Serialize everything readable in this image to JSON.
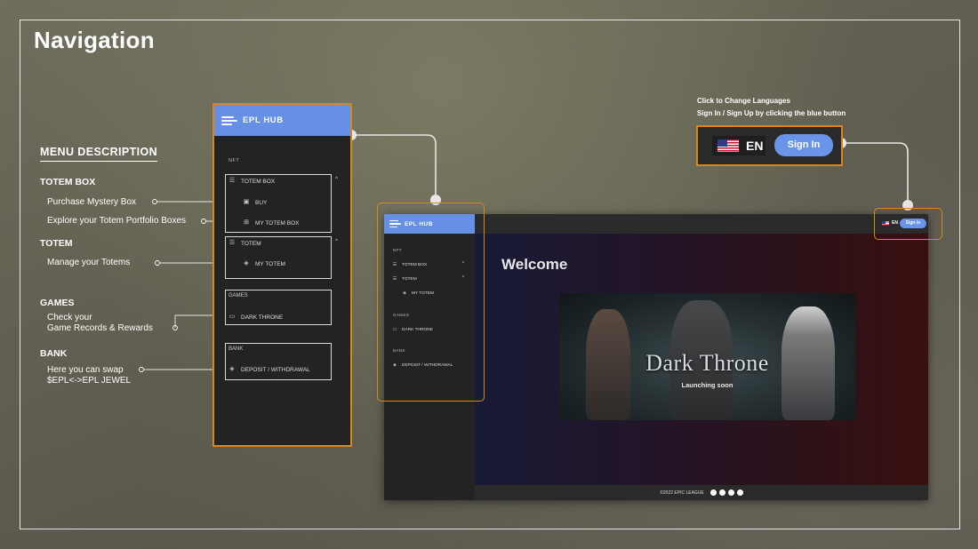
{
  "page": {
    "title": "Navigation"
  },
  "descriptions": {
    "heading": "MENU DESCRIPTION",
    "totem_box": {
      "title": "TOTEM BOX",
      "items": [
        "Purchase Mystery Box",
        "Explore your Totem Portfolio Boxes"
      ]
    },
    "totem": {
      "title": "TOTEM",
      "items": [
        "Manage your Totems"
      ]
    },
    "games": {
      "title": "GAMES",
      "line1": "Check your",
      "line2": "Game Records & Rewards"
    },
    "bank": {
      "title": "BANK",
      "line1": "Here you can swap",
      "line2": "$EPL<->EPL JEWEL"
    }
  },
  "sidebar": {
    "brand": "EPL HUB",
    "section_nft": "NFT",
    "totem_box": {
      "label": "TOTEM BOX",
      "items": [
        {
          "label": "BUY",
          "icon": "bag-icon"
        },
        {
          "label": "MY TOTEM BOX",
          "icon": "box-icon"
        }
      ]
    },
    "totem": {
      "label": "TOTEM",
      "items": [
        {
          "label": "MY TOTEM",
          "icon": "shield-icon"
        }
      ]
    },
    "games": {
      "label": "GAMES",
      "items": [
        {
          "label": "DARK THRONE",
          "icon": "ticket-icon"
        }
      ]
    },
    "bank": {
      "label": "BANK",
      "items": [
        {
          "label": "DEPOSIT / WITHDRAWAL",
          "icon": "shield-icon"
        }
      ]
    }
  },
  "language_callout": {
    "line1": "Click to Change Languages",
    "line2": "Sign In / Sign Up by clicking the blue button",
    "language": "EN",
    "signin": "Sign In"
  },
  "app": {
    "welcome": "Welcome",
    "banner_title": "Dark Throne",
    "banner_subtitle": "Launching soon",
    "footer": "©2022 EPIC LEAGUE",
    "social_icons": [
      "twitter-icon",
      "telegram-icon",
      "discord-icon",
      "medium-icon"
    ]
  },
  "colors": {
    "accent": "#6590e6",
    "highlight": "#d9861a",
    "signin": "#6a93ea"
  }
}
